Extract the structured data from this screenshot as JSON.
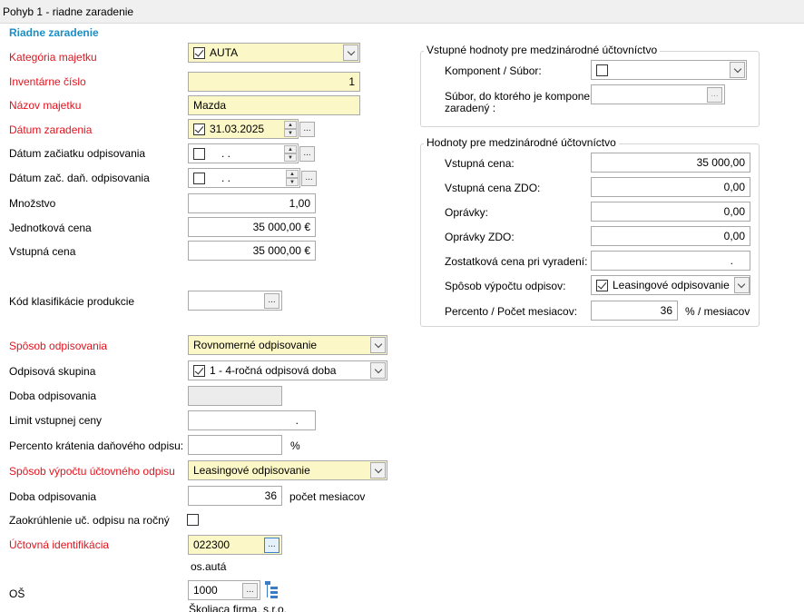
{
  "window": {
    "title": "Pohyb 1 - riadne zaradenie"
  },
  "section": {
    "title": "Riadne zaradenie"
  },
  "left": {
    "kategoria": {
      "label": "Kategória majetku",
      "value": "AUTA"
    },
    "inventarne": {
      "label": "Inventárne číslo",
      "value": "1"
    },
    "nazov": {
      "label": "Názov majetku",
      "value": "Mazda"
    },
    "datum_zaradenia": {
      "label": "Dátum zaradenia",
      "value": "31.03.2025"
    },
    "datum_odpis": {
      "label": "Dátum začiatku odpisovania",
      "value": ".  ."
    },
    "datum_dan": {
      "label": "Dátum zač. daň. odpisovania",
      "value": ".  ."
    },
    "mnozstvo": {
      "label": "Množstvo",
      "value": "1,00"
    },
    "jednotkova": {
      "label": "Jednotková cena",
      "value": "35 000,00 €"
    },
    "vstupna": {
      "label": "Vstupná cena",
      "value": "35 000,00 €"
    },
    "kod": {
      "label": "Kód klasifikácie produkcie",
      "value": ""
    },
    "sposob_odpis": {
      "label": "Spôsob odpisovania",
      "value": "Rovnomerné odpisovanie"
    },
    "skupina": {
      "label": "Odpisová skupina",
      "value": "1 - 4-ročná odpisová doba"
    },
    "doba": {
      "label": "Doba odpisovania",
      "value": ""
    },
    "limit": {
      "label": "Limit vstupnej ceny",
      "value": "."
    },
    "percento_kratenia": {
      "label": "Percento krátenia daňového odpisu:",
      "value": "",
      "unit": "%"
    },
    "sposob_uct": {
      "label": "Spôsob výpočtu účtovného odpisu",
      "value": "Leasingové odpisovanie"
    },
    "doba2": {
      "label": "Doba odpisovania",
      "value": "36",
      "unit": "počet mesiacov"
    },
    "zaokruhlenie": {
      "label": "Zaokrúhlenie uč. odpisu na ročný"
    },
    "uctovna": {
      "label": "Účtovná identifikácia",
      "value": "022300",
      "note": "os.autá"
    },
    "os": {
      "label": "OŠ",
      "value": "1000",
      "note": "Školiaca firma, s.r.o."
    }
  },
  "intl_input": {
    "title": "Vstupné hodnoty pre medzinárodné účtovníctvo",
    "komponent": {
      "label": "Komponent / Súbor:"
    },
    "subor": {
      "label_line1": "Súbor, do ktorého je komponent",
      "label_line2": "zaradený :"
    }
  },
  "intl_values": {
    "title": "Hodnoty pre medzinárodné účtovníctvo",
    "vstupna": {
      "label": "Vstupná cena:",
      "value": "35 000,00"
    },
    "vstupna_zdo": {
      "label": "Vstupná cena ZDO:",
      "value": "0,00"
    },
    "opravky": {
      "label": "Oprávky:",
      "value": "0,00"
    },
    "opravky_zdo": {
      "label": "Oprávky ZDO:",
      "value": "0,00"
    },
    "zostatkova": {
      "label": "Zostatková cena pri vyradení:",
      "value": "."
    },
    "sposob": {
      "label": "Spôsob výpočtu odpisov:",
      "value": "Leasingové odpisovanie"
    },
    "percento": {
      "label": "Percento / Počet mesiacov:",
      "value": "36",
      "unit": "% / mesiacov"
    }
  },
  "icons": {
    "ellipsis": "..."
  },
  "colors": {
    "required_label": "#e0141e",
    "section_title": "#1b8ec6",
    "required_field": "#fbf7c6"
  }
}
